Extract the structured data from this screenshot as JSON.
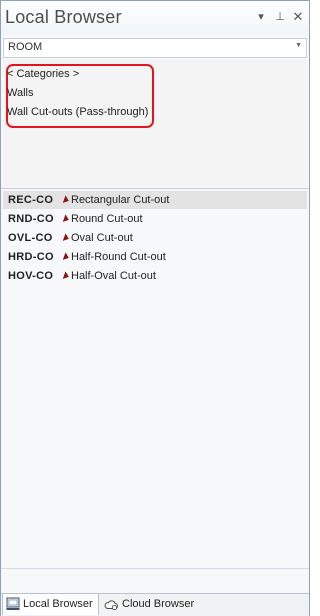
{
  "window": {
    "title": "Local Browser",
    "buttons": {
      "dropdown": "▾",
      "pin": "⊥",
      "close": "✕"
    }
  },
  "filter": {
    "selected": "ROOM"
  },
  "categories": [
    {
      "label": "< Categories >"
    },
    {
      "label": "Walls"
    },
    {
      "label": "Wall Cut-outs (Pass-through)"
    }
  ],
  "items": [
    {
      "code": "REC-CO",
      "name": "Rectangular Cut-out",
      "selected": true
    },
    {
      "code": "RND-CO",
      "name": "Round Cut-out",
      "selected": false
    },
    {
      "code": "OVL-CO",
      "name": "Oval Cut-out",
      "selected": false
    },
    {
      "code": "HRD-CO",
      "name": "Half-Round Cut-out",
      "selected": false
    },
    {
      "code": "HOV-CO",
      "name": "Half-Oval Cut-out",
      "selected": false
    }
  ],
  "tabs": [
    {
      "label": "Local Browser",
      "icon": "local-browser-icon",
      "active": true
    },
    {
      "label": "Cloud Browser",
      "icon": "cloud-browser-icon",
      "active": false
    }
  ],
  "colors": {
    "highlight": "#e3141b",
    "arrow": "#8b1515",
    "border": "#8da2c2"
  }
}
